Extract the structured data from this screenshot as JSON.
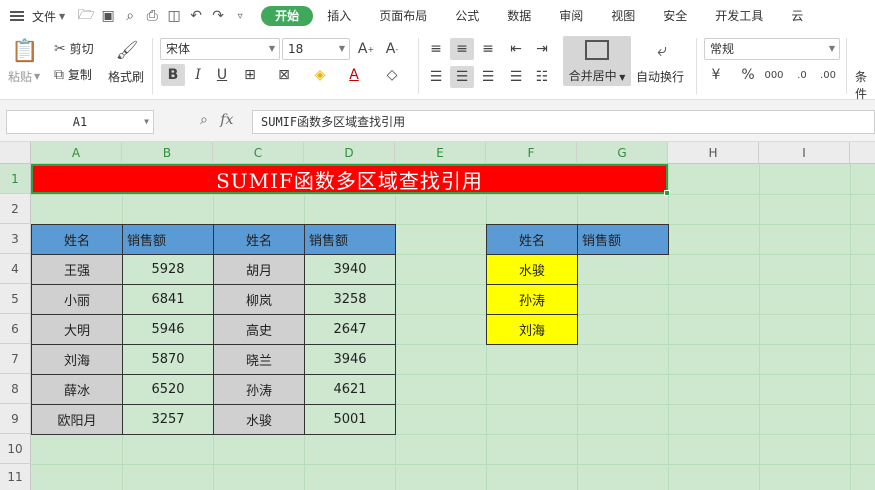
{
  "menu": {
    "file": "文件",
    "tabs": [
      "开始",
      "插入",
      "页面布局",
      "公式",
      "数据",
      "审阅",
      "视图",
      "安全",
      "开发工具",
      "云"
    ],
    "active_tab": "开始"
  },
  "ribbon": {
    "paste": "粘贴",
    "cut": "剪切",
    "copy": "复制",
    "format_painter": "格式刷",
    "font_name": "宋体",
    "font_size": "18",
    "merge_center": "合并居中",
    "wrap_text": "自动换行",
    "number_format": "常规",
    "conditional": "条件"
  },
  "formula_bar": {
    "cell_ref": "A1",
    "fx": "fx",
    "content": "SUMIF函数多区域查找引用"
  },
  "grid": {
    "columns": [
      "A",
      "B",
      "C",
      "D",
      "E",
      "F",
      "G",
      "H",
      "I"
    ],
    "rows": [
      "1",
      "2",
      "3",
      "4",
      "5",
      "6",
      "7",
      "8",
      "9",
      "10",
      "11"
    ],
    "title": "SUMIF函数多区域查找引用",
    "table1_headers": [
      "姓名",
      "销售额",
      "姓名",
      "销售额"
    ],
    "table1_rows": [
      [
        "王强",
        "5928",
        "胡月",
        "3940"
      ],
      [
        "小丽",
        "6841",
        "柳岚",
        "3258"
      ],
      [
        "大明",
        "5946",
        "高史",
        "2647"
      ],
      [
        "刘海",
        "5870",
        "晓兰",
        "3946"
      ],
      [
        "薛冰",
        "6520",
        "孙涛",
        "4621"
      ],
      [
        "欧阳月",
        "3257",
        "水骏",
        "5001"
      ]
    ],
    "table2_headers": [
      "姓名",
      "销售额"
    ],
    "table2_names": [
      "水骏",
      "孙涛",
      "刘海"
    ]
  },
  "colors": {
    "accent": "#3fa85a",
    "title_bg": "#ff0000",
    "header_blue": "#5b9bd5",
    "name_gray": "#d0d0d0",
    "lookup_yellow": "#ffff00",
    "sheet_green": "#cde8cf"
  }
}
